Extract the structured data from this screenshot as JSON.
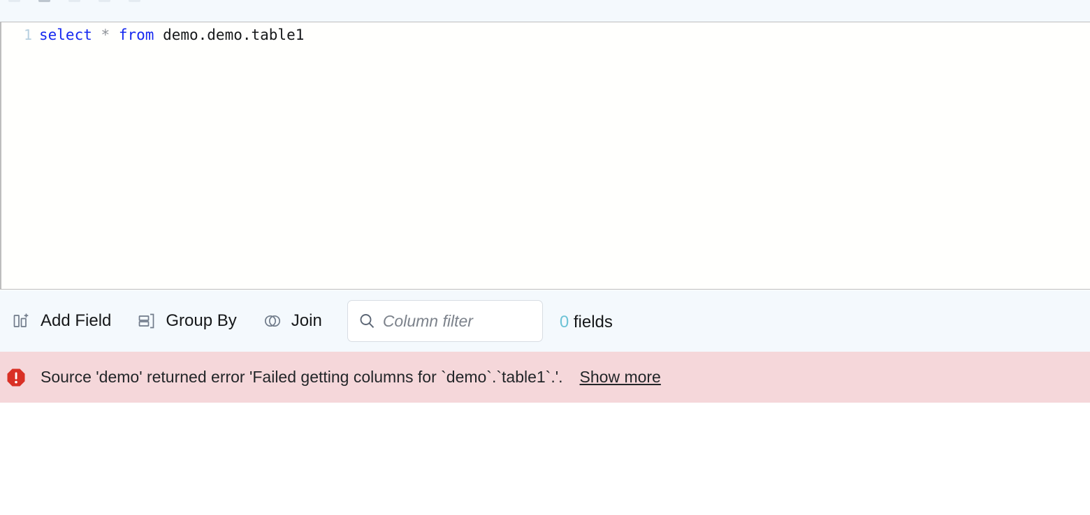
{
  "editor": {
    "line_number": "1",
    "sql": {
      "keyword_select": "select",
      "star": "*",
      "keyword_from": "from",
      "table_reference": "demo.demo.table1"
    },
    "full_query": "select * from demo.demo.table1"
  },
  "toolbar": {
    "add_field_label": "Add Field",
    "add_field_icon": "add-column-icon",
    "group_by_label": "Group By",
    "group_by_icon": "group-rows-icon",
    "join_label": "Join",
    "join_icon": "venn-circles-icon",
    "filter": {
      "icon": "search-icon",
      "placeholder": "Column filter",
      "value": ""
    },
    "field_count_number": "0",
    "field_count_label": "fields"
  },
  "error": {
    "icon": "error-octagon-icon",
    "message": "Source 'demo' returned error 'Failed getting columns for `demo`.`table1`.'.",
    "show_more_label": "Show more"
  },
  "colors": {
    "toolbar_bg": "#f4f9fd",
    "error_bg": "#f5d7da",
    "error_icon": "#d93025",
    "keyword": "#1528f0",
    "count_accent": "#6dc3d6",
    "gutter": "#b6cfdf"
  }
}
